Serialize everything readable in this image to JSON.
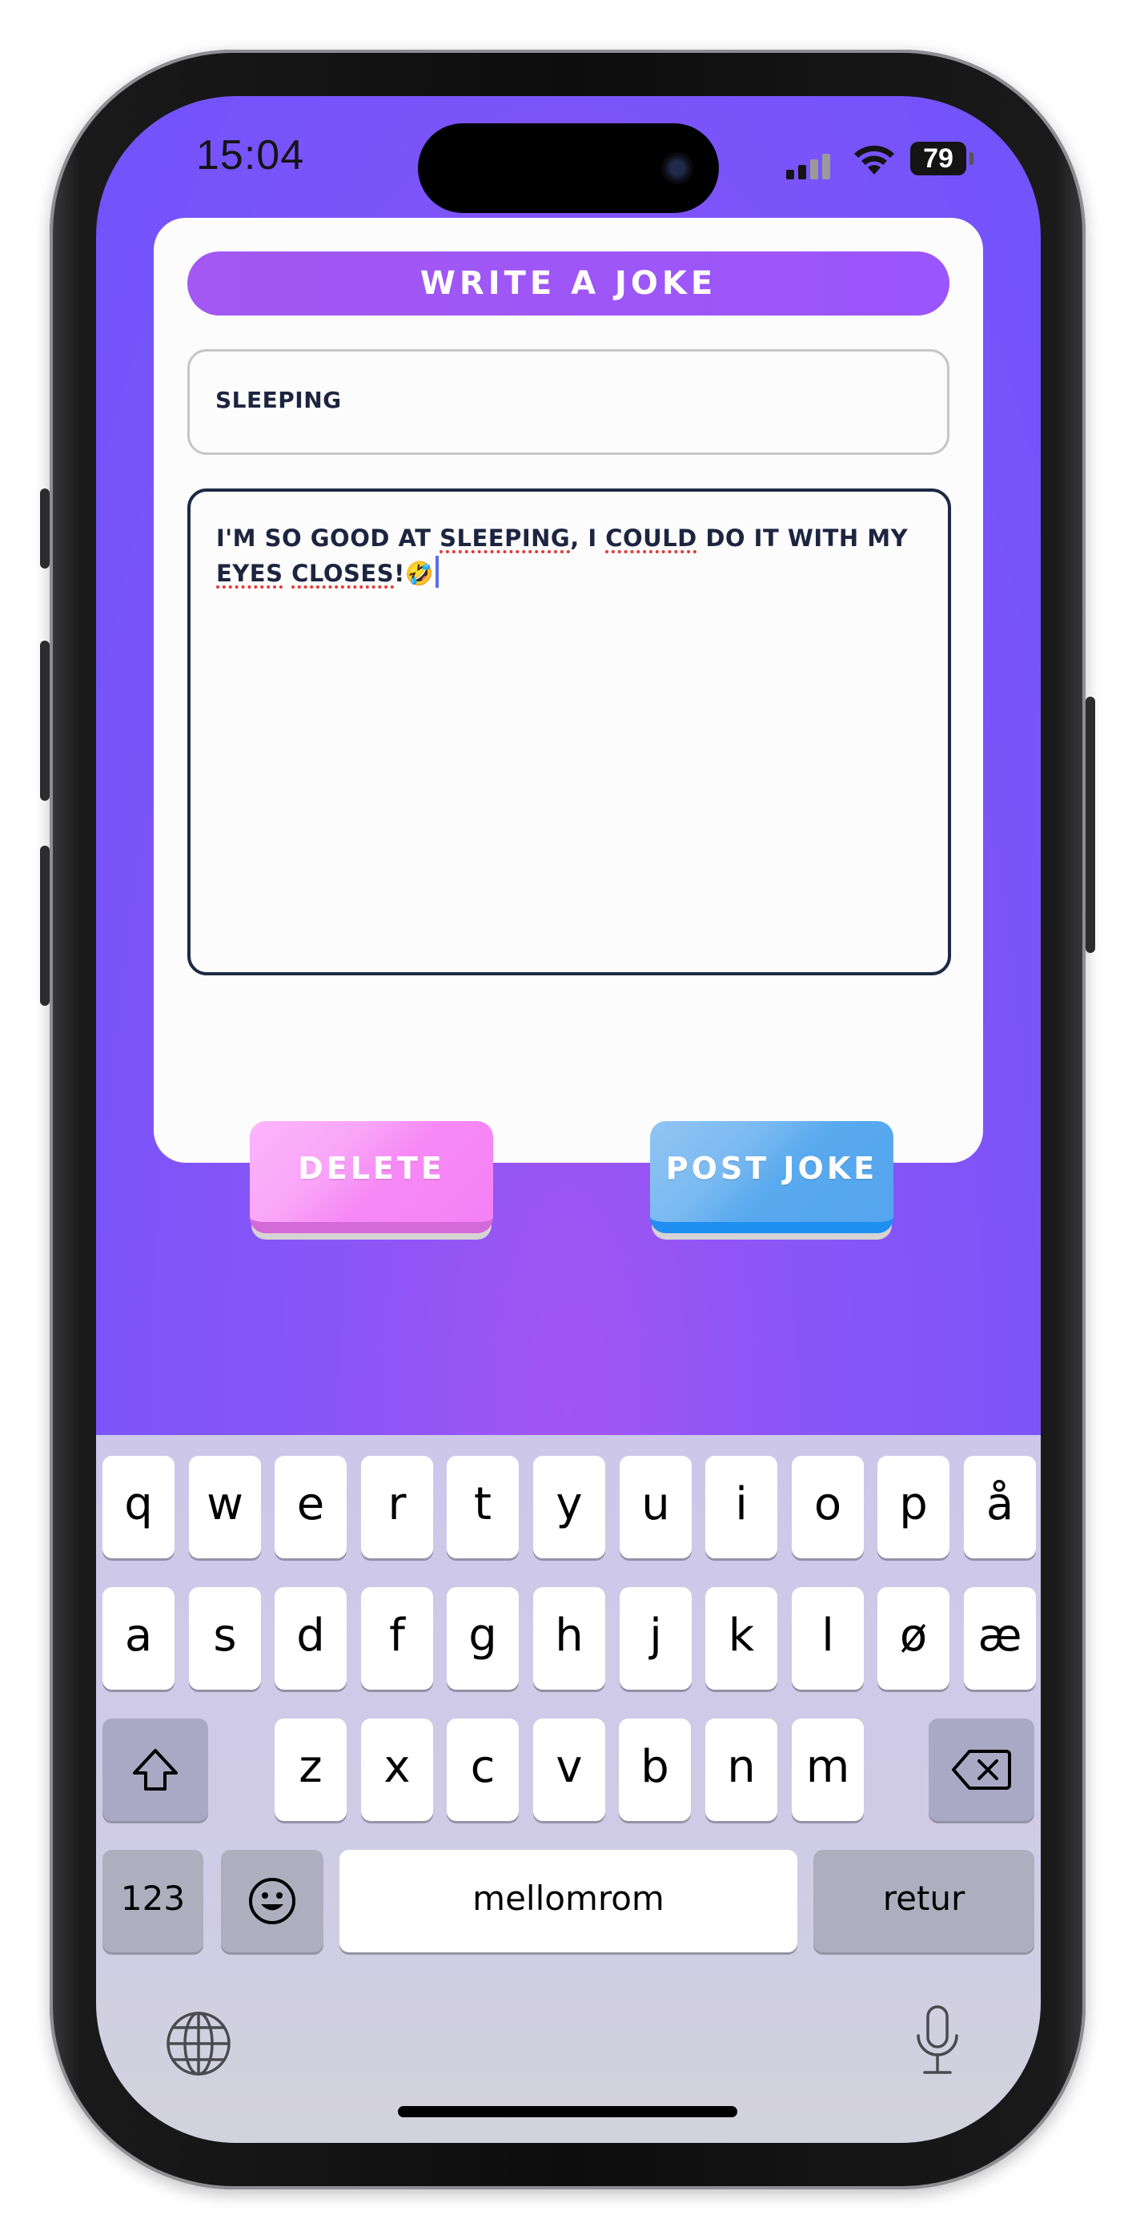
{
  "status_bar": {
    "time": "15:04",
    "battery": "79",
    "icons": [
      "signal-icon",
      "wifi-icon",
      "battery-icon"
    ]
  },
  "card": {
    "title": "WRITE A JOKE",
    "topic_value": "SLEEPING",
    "joke": {
      "p1": "I'M SO GOOD AT ",
      "w1": "SLEEPING",
      "p2": ", I ",
      "w2": "COULD",
      "p3": " DO IT WITH MY ",
      "w3": "EYES",
      "p4": " ",
      "w4": "CLOSES",
      "p5": "!",
      "emoji": "🤣"
    },
    "delete_label": "DELETE",
    "post_label": "POST JOKE"
  },
  "colors": {
    "background": "#6f54fb",
    "title_bar": "#a258f1",
    "delete_button": "#f68af5",
    "post_button": "#58a9ee",
    "text_dark": "#1c2540"
  },
  "keyboard": {
    "row1": [
      "q",
      "w",
      "e",
      "r",
      "t",
      "y",
      "u",
      "i",
      "o",
      "p",
      "å"
    ],
    "row2": [
      "a",
      "s",
      "d",
      "f",
      "g",
      "h",
      "j",
      "k",
      "l",
      "ø",
      "æ"
    ],
    "row3": [
      "z",
      "x",
      "c",
      "v",
      "b",
      "n",
      "m"
    ],
    "numbers_label": "123",
    "space_label": "mellomrom",
    "return_label": "retur",
    "icons": [
      "shift-icon",
      "backspace-icon",
      "emoji-icon",
      "globe-icon",
      "microphone-icon"
    ]
  }
}
